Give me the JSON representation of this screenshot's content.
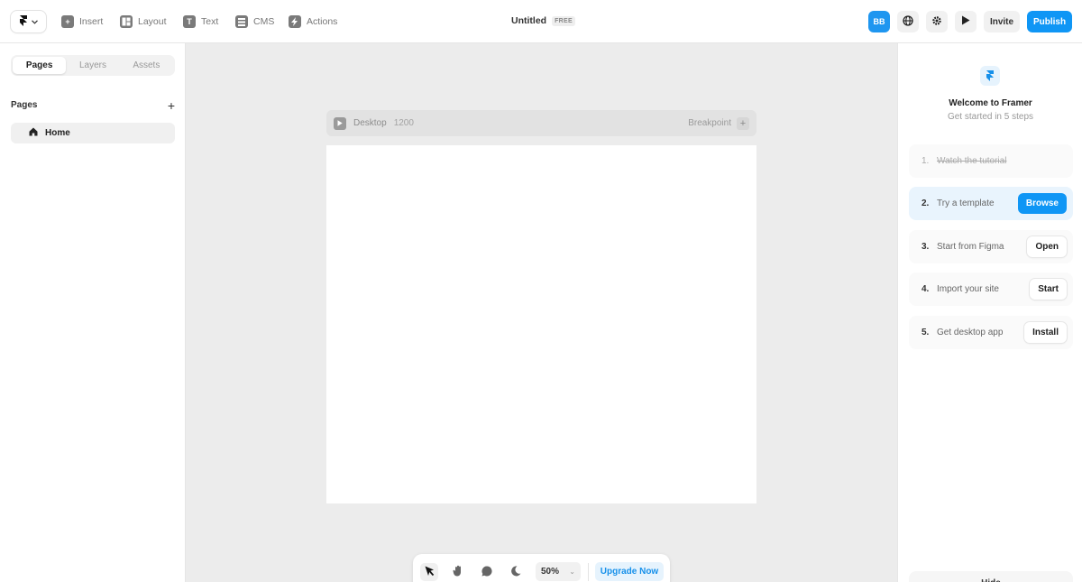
{
  "toolbar": {
    "logo_icon": "framer-logo-icon",
    "tools": [
      {
        "label": "Insert",
        "icon": "plus-square-icon"
      },
      {
        "label": "Layout",
        "icon": "layout-icon"
      },
      {
        "label": "Text",
        "icon": "text-icon"
      },
      {
        "label": "CMS",
        "icon": "cms-icon"
      },
      {
        "label": "Actions",
        "icon": "bolt-icon"
      }
    ],
    "title": "Untitled",
    "plan_badge": "FREE",
    "avatar_initials": "BB",
    "invite_label": "Invite",
    "publish_label": "Publish"
  },
  "left_panel": {
    "tabs": [
      "Pages",
      "Layers",
      "Assets"
    ],
    "active_tab": "Pages",
    "section_title": "Pages",
    "pages": [
      {
        "label": "Home",
        "icon": "home-icon"
      }
    ]
  },
  "canvas": {
    "frame_name": "Desktop",
    "frame_width": "1200",
    "breakpoint_label": "Breakpoint"
  },
  "bottom_toolbar": {
    "tools": [
      "cursor-icon",
      "hand-icon",
      "comment-icon",
      "moon-icon"
    ],
    "zoom": "50%",
    "upgrade_label": "Upgrade Now"
  },
  "right_panel": {
    "title": "Welcome to Framer",
    "subtitle": "Get started in 5 steps",
    "steps": [
      {
        "num": "1.",
        "label": "Watch the tutorial",
        "button": ""
      },
      {
        "num": "2.",
        "label": "Try a template",
        "button": "Browse"
      },
      {
        "num": "3.",
        "label": "Start from Figma",
        "button": "Open"
      },
      {
        "num": "4.",
        "label": "Import your site",
        "button": "Start"
      },
      {
        "num": "5.",
        "label": "Get desktop app",
        "button": "Install"
      }
    ],
    "hide_label": "Hide"
  },
  "colors": {
    "accent": "#0f96f5",
    "canvas_bg": "#ececec",
    "panel_bg": "#ffffff"
  }
}
